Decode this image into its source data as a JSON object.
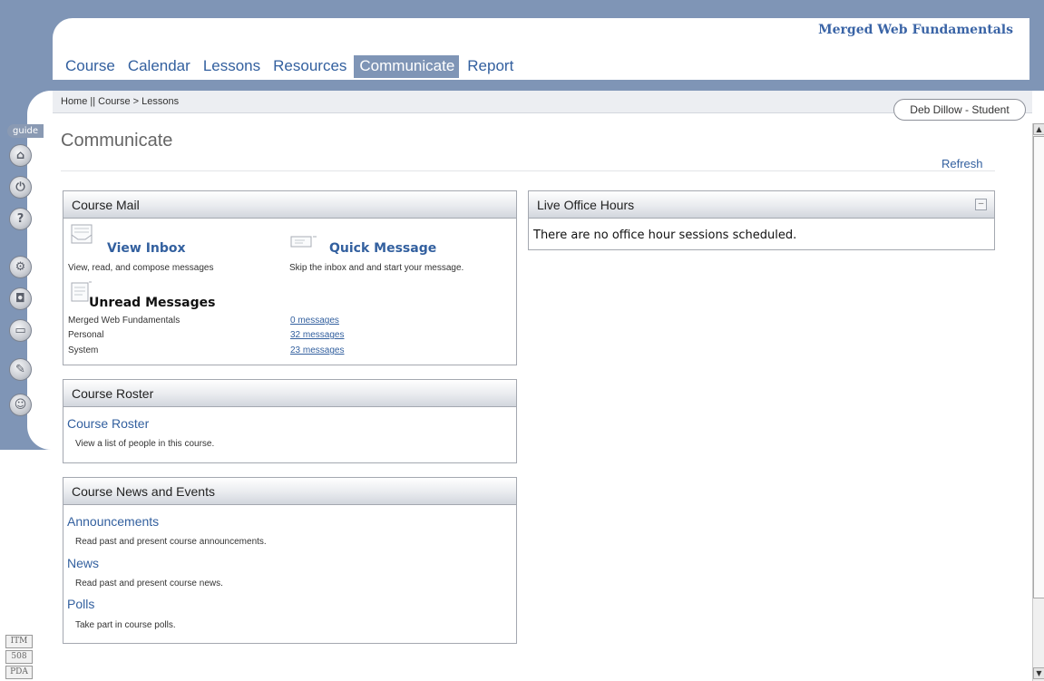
{
  "header": {
    "course_title": "Merged Web Fundamentals",
    "tabs": [
      "Course",
      "Calendar",
      "Lessons",
      "Resources",
      "Communicate",
      "Report"
    ],
    "active_tab": "Communicate"
  },
  "sidebar": {
    "guide_label": "guide",
    "icons": [
      "home-icon",
      "power-icon",
      "help-icon",
      "settings-icon",
      "camera-icon",
      "folder-icon",
      "wrench-icon",
      "chat-icon"
    ],
    "badges": [
      "ITM",
      "508",
      "PDA"
    ]
  },
  "breadcrumb": "Home || Course > Lessons",
  "user": "Deb Dillow - Student",
  "page": {
    "title": "Communicate",
    "refresh_label": "Refresh"
  },
  "course_mail": {
    "header": "Course Mail",
    "view_inbox": {
      "label": "View Inbox",
      "desc": "View, read, and compose messages"
    },
    "quick_message": {
      "label": "Quick Message",
      "desc": "Skip the inbox and and start your message."
    },
    "unread_title": "Unread Messages",
    "unread_rows": [
      {
        "label": "Merged Web Fundamentals",
        "count": "0 messages"
      },
      {
        "label": "Personal",
        "count": "32 messages"
      },
      {
        "label": "System",
        "count": "23 messages"
      }
    ]
  },
  "course_roster": {
    "header": "Course Roster",
    "link": "Course Roster",
    "desc": "View a list of people in this course."
  },
  "news_events": {
    "header": "Course News and Events",
    "items": [
      {
        "label": "Announcements",
        "desc": "Read past and present course announcements."
      },
      {
        "label": "News",
        "desc": "Read past and present course news."
      },
      {
        "label": "Polls",
        "desc": "Take part in course polls."
      }
    ]
  },
  "live_office_hours": {
    "header": "Live Office Hours",
    "collapse_glyph": "–",
    "message": "There are no office hour sessions scheduled."
  }
}
